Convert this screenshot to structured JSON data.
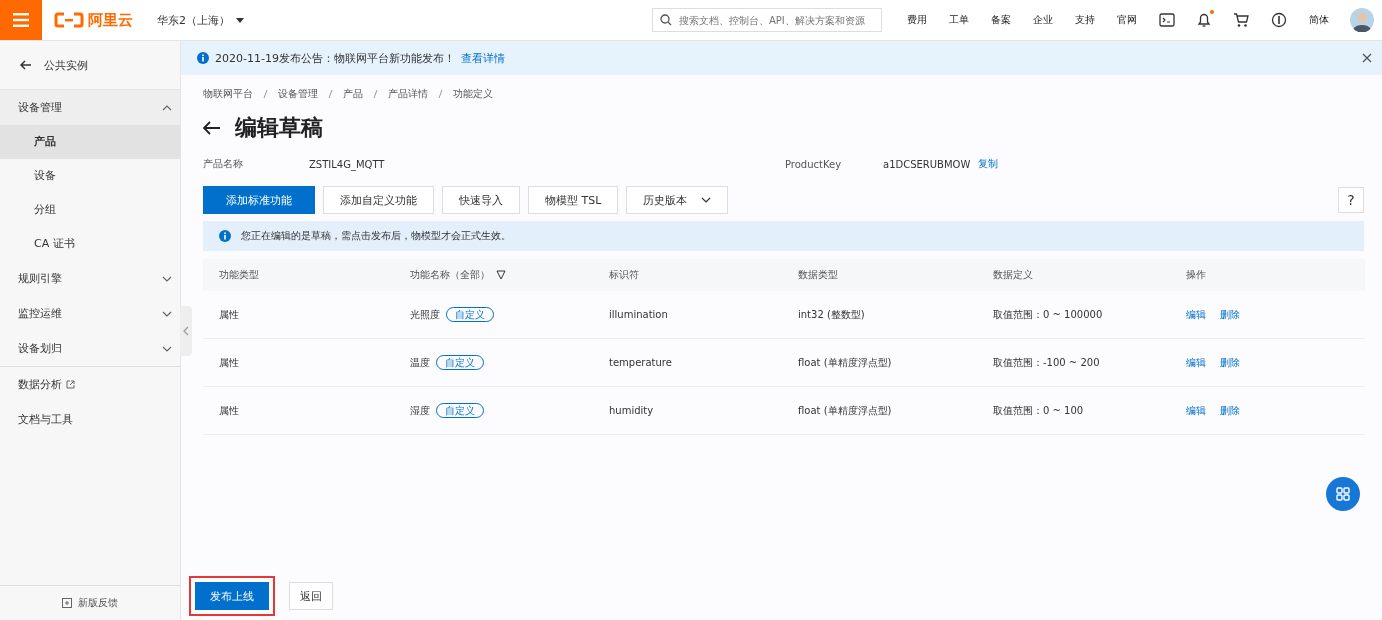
{
  "topbar": {
    "logo": "阿里云",
    "region": "华东2（上海）",
    "search": {
      "placeholder": "搜索文档、控制台、API、解决方案和资源"
    },
    "nav": [
      "费用",
      "工单",
      "备案",
      "企业",
      "支持",
      "官网"
    ],
    "language": "简体",
    "bell_dot": true
  },
  "sidebar": {
    "back": "公共实例",
    "items": [
      {
        "label": "设备管理",
        "expanded": true,
        "children": [
          {
            "label": "产品",
            "selected": true
          },
          {
            "label": "设备",
            "selected": false
          },
          {
            "label": "分组",
            "selected": false
          },
          {
            "label": "CA 证书",
            "selected": false
          }
        ]
      },
      {
        "label": "规则引擎",
        "expanded": false
      },
      {
        "label": "监控运维",
        "expanded": false
      },
      {
        "label": "设备划归",
        "expanded": false
      },
      {
        "label": "数据分析",
        "external": true
      },
      {
        "label": "文档与工具"
      }
    ],
    "feedback": "新版反馈"
  },
  "notice": {
    "text": "2020-11-19发布公告：物联网平台新功能发布！",
    "link": "查看详情"
  },
  "breadcrumb": [
    "物联网平台",
    "设备管理",
    "产品",
    "产品详情",
    "功能定义"
  ],
  "title": "编辑草稿",
  "info": [
    {
      "label": "产品名称",
      "value": "ZSTIL4G_MQTT"
    },
    {
      "label": "ProductKey",
      "value": "a1DCSERUBMOW",
      "action": "复制"
    }
  ],
  "toolbar": [
    {
      "label": "添加标准功能",
      "primary": true
    },
    {
      "label": "添加自定义功能",
      "primary": false
    },
    {
      "label": "快速导入",
      "primary": false
    },
    {
      "label": "物模型 TSL",
      "primary": false
    },
    {
      "label": "历史版本",
      "primary": false,
      "dropdown": true
    }
  ],
  "help": "?",
  "alert": "您正在编辑的是草稿，需点击发布后，物模型才会正式生效。",
  "table": {
    "columns": [
      "功能类型",
      "功能名称（全部）",
      "标识符",
      "数据类型",
      "数据定义",
      "操作"
    ],
    "rows": [
      {
        "type": "属性",
        "name": "光照度",
        "tag": "自定义",
        "identifier": "illumination",
        "data_type": "int32 (整数型)",
        "definition": "取值范围：0 ~ 100000",
        "actions": [
          "编辑",
          "删除"
        ]
      },
      {
        "type": "属性",
        "name": "温度",
        "tag": "自定义",
        "identifier": "temperature",
        "data_type": "float (单精度浮点型)",
        "definition": "取值范围：-100 ~ 200",
        "actions": [
          "编辑",
          "删除"
        ]
      },
      {
        "type": "属性",
        "name": "湿度",
        "tag": "自定义",
        "identifier": "humidity",
        "data_type": "float (单精度浮点型)",
        "definition": "取值范围：0 ~ 100",
        "actions": [
          "编辑",
          "删除"
        ]
      }
    ]
  },
  "footer": [
    {
      "label": "发布上线",
      "primary": true,
      "highlighted": true
    },
    {
      "label": "返回",
      "primary": false,
      "highlighted": false
    }
  ]
}
